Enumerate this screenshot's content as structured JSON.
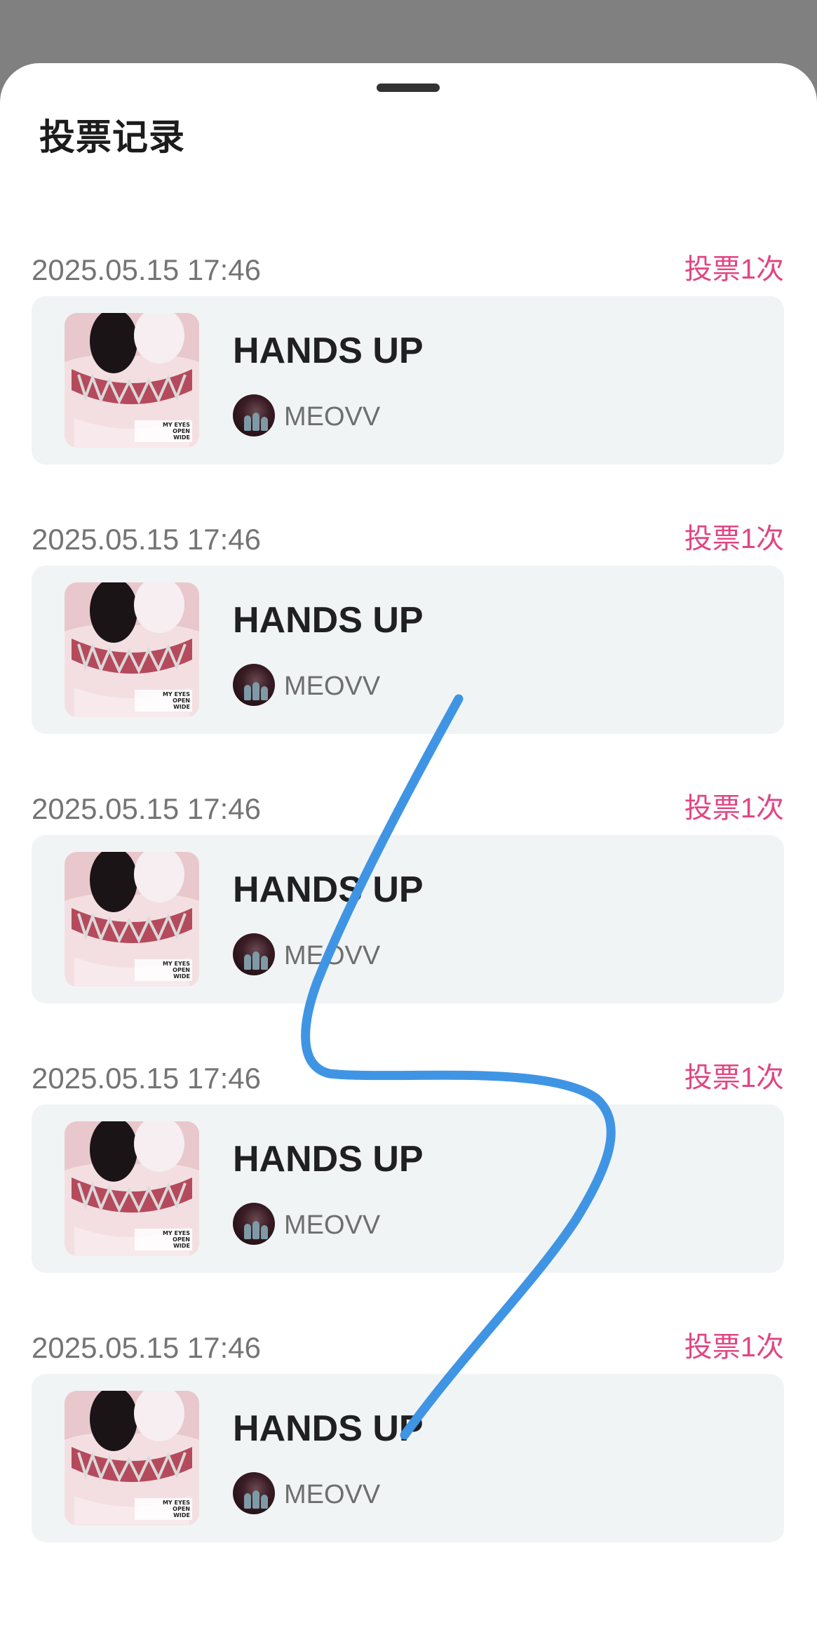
{
  "sheet": {
    "title": "投票记录"
  },
  "records": [
    {
      "time": "2025.05.15 17:46",
      "count": "投票1次",
      "song": "HANDS UP",
      "artist": "MEOVV",
      "cover_text": [
        "MY EYES",
        "OPEN",
        "WIDE"
      ]
    },
    {
      "time": "2025.05.15 17:46",
      "count": "投票1次",
      "song": "HANDS UP",
      "artist": "MEOVV",
      "cover_text": [
        "MY EYES",
        "OPEN",
        "WIDE"
      ]
    },
    {
      "time": "2025.05.15 17:46",
      "count": "投票1次",
      "song": "HANDS UP",
      "artist": "MEOVV",
      "cover_text": [
        "MY EYES",
        "OPEN",
        "WIDE"
      ]
    },
    {
      "time": "2025.05.15 17:46",
      "count": "投票1次",
      "song": "HANDS UP",
      "artist": "MEOVV",
      "cover_text": [
        "MY EYES",
        "OPEN",
        "WIDE"
      ]
    },
    {
      "time": "2025.05.15 17:46",
      "count": "投票1次",
      "song": "HANDS UP",
      "artist": "MEOVV",
      "cover_text": [
        "MY EYES",
        "OPEN",
        "WIDE"
      ]
    }
  ],
  "colors": {
    "overlay": "#808080",
    "accent_pink": "#e04683",
    "card_bg": "#f1f4f5",
    "scribble": "#3f95e4"
  }
}
